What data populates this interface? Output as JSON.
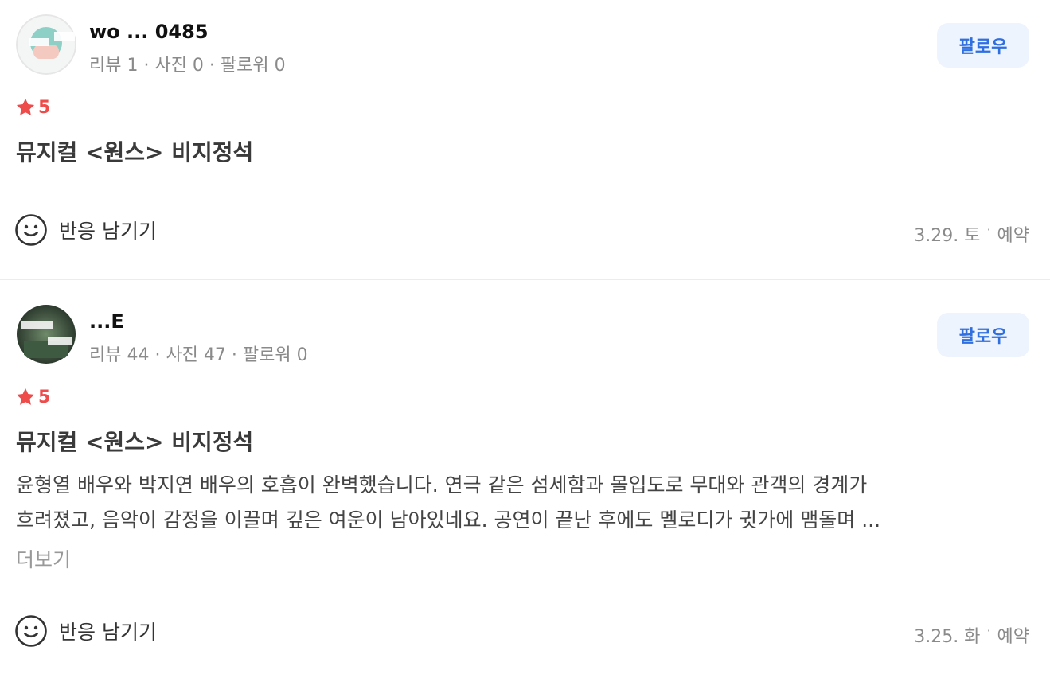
{
  "reviews": [
    {
      "username": "wo  ...   0485",
      "stats": "리뷰 1 · 사진 0 · 팔로워 0",
      "follow_label": "팔로우",
      "rating": "5",
      "title": "뮤지컬 <원스> 비지정석",
      "react_label": "반응 남기기",
      "date": "3.29. 토",
      "booking": "예약",
      "colors": {
        "accent": "#2f6fe0",
        "star": "#ee4b4b"
      }
    },
    {
      "username": "...E",
      "stats": "리뷰 44 · 사진 47 · 팔로워 0",
      "follow_label": "팔로우",
      "rating": "5",
      "title": "뮤지컬 <원스> 비지정석",
      "body_lines": [
        "윤형열 배우와 박지연 배우의 호흡이 완벽했습니다. 연극 같은 섬세함과 몰입도로 무대와 관객의 경계가",
        "흐려졌고, 음악이 감정을 이끌며 깊은 여운이 남아있네요. 공연이 끝난 후에도 멜로디가 귓가에 맴돌며 ..."
      ],
      "more_label": "더보기",
      "react_label": "반응 남기기",
      "date": "3.25. 화",
      "booking": "예약"
    }
  ]
}
